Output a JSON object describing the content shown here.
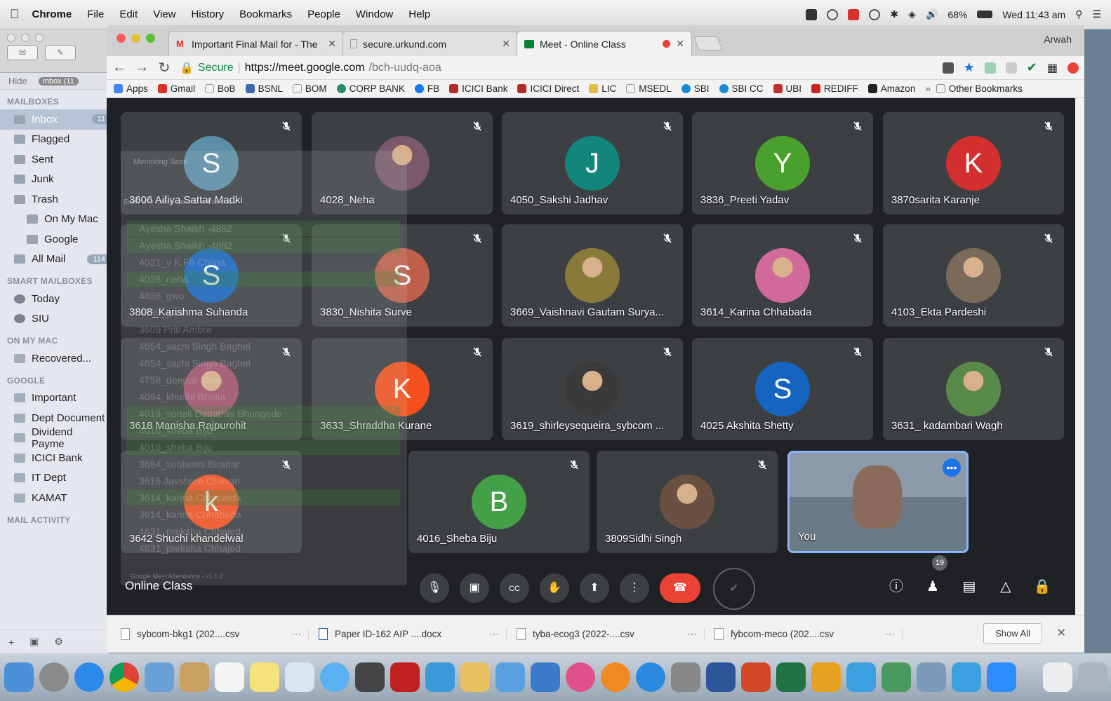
{
  "menubar": {
    "app": "Chrome",
    "items": [
      "File",
      "Edit",
      "View",
      "History",
      "Bookmarks",
      "People",
      "Window",
      "Help"
    ],
    "battery": "68%",
    "clock": "Wed 11:43 am"
  },
  "mail": {
    "hide_label": "Hide",
    "inbox_pill": "Inbox (11",
    "sections": {
      "mailboxes": "MAILBOXES",
      "smart": "SMART MAILBOXES",
      "on_my_mac": "ON MY MAC",
      "google": "GOOGLE",
      "activity": "MAIL ACTIVITY"
    },
    "mailboxes": [
      {
        "label": "Inbox",
        "badge": "11"
      },
      {
        "label": "Flagged",
        "badge": ""
      },
      {
        "label": "Sent",
        "badge": ""
      },
      {
        "label": "Junk",
        "badge": ""
      },
      {
        "label": "Trash",
        "badge": ""
      },
      {
        "label": "On My Mac",
        "badge": ""
      },
      {
        "label": "Google",
        "badge": ""
      },
      {
        "label": "All Mail",
        "badge": "114"
      }
    ],
    "smart": [
      "Today",
      "SIU"
    ],
    "on_my_mac": [
      "Recovered..."
    ],
    "google": [
      "Important",
      "Dept Document",
      "Dividend Payme",
      "ICICI Bank",
      "IT Dept",
      "KAMAT"
    ]
  },
  "browser": {
    "profile": "Arwah",
    "tabs": [
      {
        "title": "Important Final Mail for - The"
      },
      {
        "title": "secure.urkund.com"
      },
      {
        "title": "Meet - Online Class"
      }
    ],
    "url_secure": "Secure",
    "url_host": "https://meet.google.com",
    "url_path": "/bch-uudq-aoa",
    "bookmarks": [
      "Apps",
      "Gmail",
      "BoB",
      "BSNL",
      "BOM",
      "CORP BANK",
      "FB",
      "ICICI Bank",
      "ICICI Direct",
      "LIC",
      "MSEDL",
      "SBI",
      "SBI CC",
      "UBI",
      "REDIFF",
      "Amazon"
    ],
    "other_bookmarks": "Other Bookmarks"
  },
  "meet": {
    "meeting_title": "Online Class",
    "participant_count": "19",
    "tiles": [
      {
        "name": "3606 Aifiya Sattar Madki",
        "initial": "S",
        "color": "#5a8fa8"
      },
      {
        "name": "4028_Neha",
        "initial": "",
        "color": "#7a5a6a"
      },
      {
        "name": "4050_Sakshi Jadhav",
        "initial": "J",
        "color": "#12867a"
      },
      {
        "name": "3836_Preeti Yadav",
        "initial": "Y",
        "color": "#4aa02c"
      },
      {
        "name": "3870sarita Karanje",
        "initial": "K",
        "color": "#d32f2f"
      },
      {
        "name": "3808_Karishma Suhanda",
        "initial": "S",
        "color": "#1565c0"
      },
      {
        "name": "3830_Nishita Surve",
        "initial": "S",
        "color": "#c0604a"
      },
      {
        "name": "3669_Vaishnavi Gautam Surya...",
        "initial": "",
        "color": "#8a7a3a"
      },
      {
        "name": "3614_Karina Chhabada",
        "initial": "",
        "color": "#d06a9a"
      },
      {
        "name": "4103_Ekta Pardeshi",
        "initial": "",
        "color": "#7a6a5a"
      },
      {
        "name": "3618 Manisha Rajpurohit",
        "initial": "",
        "color": "#a0506a"
      },
      {
        "name": "3633_Shraddha Kurane",
        "initial": "K",
        "color": "#f4511e"
      },
      {
        "name": "3619_shirleysequeira_sybcom ...",
        "initial": "",
        "color": "#3a3a3a"
      },
      {
        "name": "4025 Akshita Shetty",
        "initial": "S",
        "color": "#1565c0"
      },
      {
        "name": "3631_ kadambari Wagh",
        "initial": "",
        "color": "#5a8a4a"
      },
      {
        "name": "3642 Shuchi khandelwal",
        "initial": "k",
        "color": "#f4511e"
      },
      {
        "name": "4016_Sheba Biju",
        "initial": "B",
        "color": "#43a047"
      },
      {
        "name": "3809Sidhi Singh",
        "initial": "",
        "color": "#6a5040"
      },
      {
        "name": "You",
        "initial": "",
        "color": "#8a6a5a"
      }
    ],
    "overlay": {
      "title": "Mentoring Sess",
      "hint": "Enter any notes specific to this class",
      "rows": [
        "Ayesha Shaikh -4882",
        "Ayesha Shaikh -4882",
        "4021_v K.Fh Chiina",
        "4028_neha",
        "4836_gwo",
        "4836_gwo",
        "3609 Priti Ambre",
        "4654_sachi Singh Baghel",
        "4654_sachi Singh Baghel",
        "4758_deepali More",
        "4094_khushi Bhatia",
        "4019_soneli Dattatray Bhungede",
        "4016_sheba Biju",
        "4016_sheba Biju",
        "3684_sublaxmi Biradar",
        "3615 Javshree Chavan",
        "3614_karina Chhabada",
        "3614_karina Chhabada",
        "4831_preksha Chhajed",
        "4831_preksha Chhajed"
      ],
      "footer": "Google Meet Attendance - v1.1.2"
    }
  },
  "downloads": {
    "files": [
      "sybcom-bkg1 (202....csv",
      "Paper ID-162 AIP ....docx",
      "tyba-ecog3 (2022-....csv",
      "fybcom-meco (202....csv"
    ],
    "show_all": "Show All"
  },
  "colors": {
    "meet_bg": "#202124",
    "tile_bg": "#3c4043",
    "end_call": "#ea4335",
    "you_border": "#8ab4f8"
  }
}
